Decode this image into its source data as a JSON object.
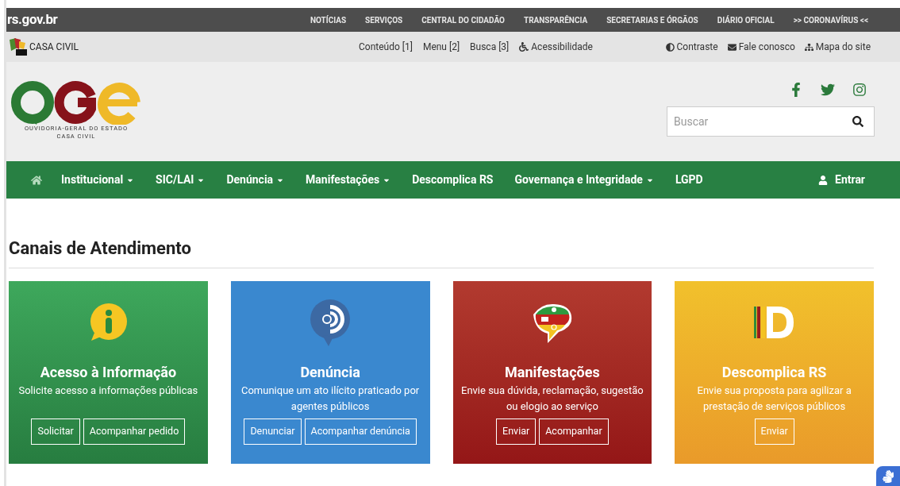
{
  "top_bar": {
    "brand": "rs.gov.br",
    "links": [
      "NOTÍCIAS",
      "SERVIÇOS",
      "CENTRAL DO CIDADÃO",
      "TRANSPARÊNCIA",
      "SECRETARIAS E ÓRGÃOS",
      "DIÁRIO OFICIAL",
      ">> CORONAVÍRUS <<"
    ]
  },
  "sub_bar": {
    "org": "CASA CIVIL",
    "shortcuts": [
      "Conteúdo [1]",
      "Menu [2]",
      "Busca [3]"
    ],
    "accessibility": "Acessibilidade",
    "tools": [
      {
        "kind": "contrast",
        "label": "Contraste"
      },
      {
        "kind": "mail",
        "label": "Fale conosco"
      },
      {
        "kind": "sitemap",
        "label": "Mapa do site"
      }
    ]
  },
  "header": {
    "logo_lines": [
      "OUVIDORIA-GERAL DO ESTADO",
      "CASA CIVIL"
    ],
    "social": [
      {
        "kind": "facebook"
      },
      {
        "kind": "twitter"
      },
      {
        "kind": "instagram"
      }
    ],
    "search": {
      "placeholder": "Buscar"
    }
  },
  "nav": {
    "items": [
      {
        "label": "Institucional",
        "dropdown": true
      },
      {
        "label": "SIC/LAI",
        "dropdown": true
      },
      {
        "label": "Denúncia",
        "dropdown": true
      },
      {
        "label": "Manifestações",
        "dropdown": true
      },
      {
        "label": "Descomplica RS",
        "dropdown": false
      },
      {
        "label": "Governança e Integridade",
        "dropdown": true
      },
      {
        "label": "LGPD",
        "dropdown": false
      }
    ],
    "login": "Entrar"
  },
  "section": {
    "title": "Canais de Atendimento"
  },
  "cards": [
    {
      "kind": "info",
      "title": "Acesso à Informação",
      "text": "Solicite acesso a informações públicas",
      "buttons": [
        "Solicitar",
        "Acompanhar pedido"
      ]
    },
    {
      "kind": "complaint",
      "title": "Denúncia",
      "text": "Comunique um ato ilícito praticado por agentes públicos",
      "buttons": [
        "Denunciar",
        "Acompanhar denúncia"
      ]
    },
    {
      "kind": "manifest",
      "title": "Manifestações",
      "text": "Envie sua dúvida, reclamação, sugestão ou elogio ao serviço",
      "buttons": [
        "Enviar",
        "Acompanhar"
      ]
    },
    {
      "kind": "simplify",
      "title": "Descomplica RS",
      "text": "Envie sua proposta para agilizar a prestação de serviços públicos",
      "buttons": [
        "Enviar"
      ]
    }
  ]
}
